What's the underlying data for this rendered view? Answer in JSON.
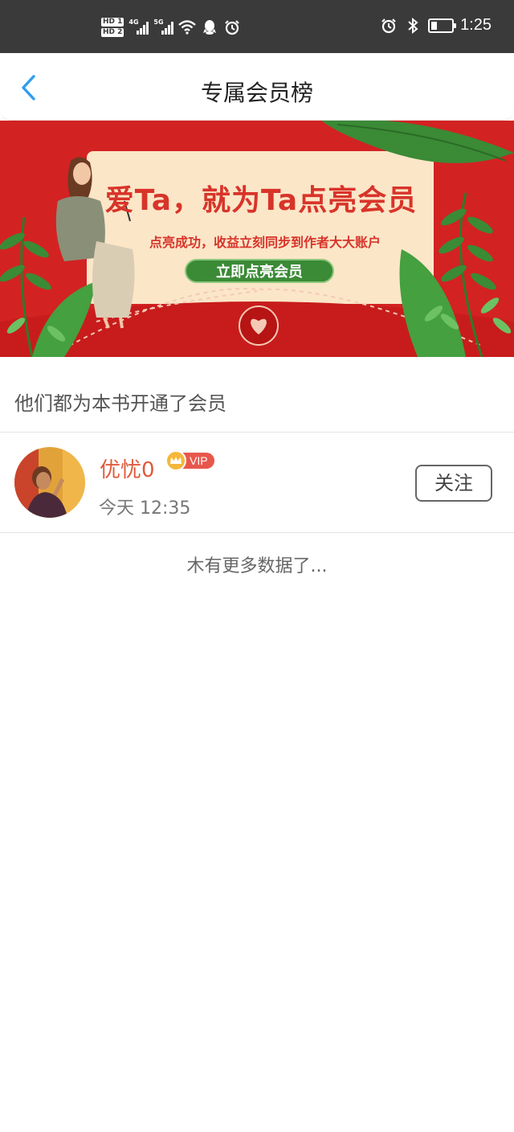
{
  "status_bar": {
    "sim1": "HD 1",
    "sim2": "HD 2",
    "net1": "4G",
    "net2": "5G",
    "time": "1:25",
    "battery_level": 0.3,
    "icons": [
      "wifi-icon",
      "qq-icon",
      "alarm-icon",
      "alarm-icon",
      "bluetooth-icon",
      "battery-icon"
    ]
  },
  "nav": {
    "title": "专属会员榜",
    "back_icon": "chevron-left-icon",
    "accent": "#2f9df0"
  },
  "banner": {
    "title": "爱Ta，就为Ta点亮会员",
    "subtitle": "点亮成功，收益立刻同步到作者大大账户",
    "button": "立即点亮会员",
    "colors": {
      "background": "#d32222",
      "card": "#fbe6c8",
      "button": "#3b8a36"
    }
  },
  "section": {
    "title": "他们都为本书开通了会员"
  },
  "members": [
    {
      "name": "优忧0",
      "badge": "VIP",
      "time": "今天 12:35",
      "follow_label": "关注"
    }
  ],
  "footer": {
    "no_more": "木有更多数据了..."
  }
}
